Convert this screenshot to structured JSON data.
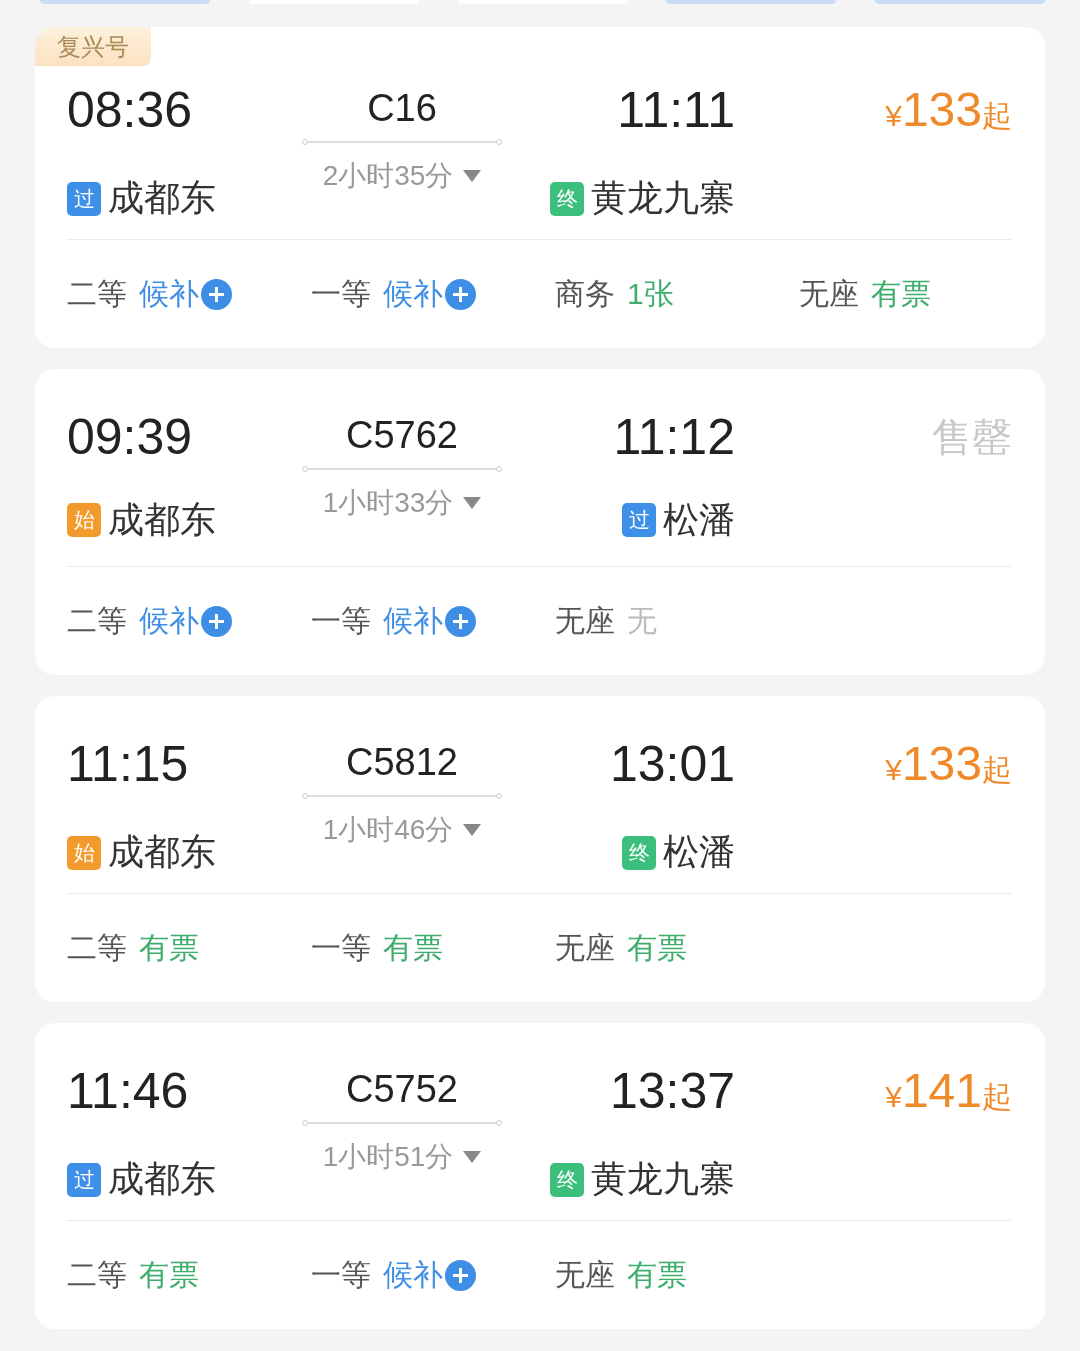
{
  "filter_chips": [
    {
      "selected": true
    },
    {
      "selected": false
    },
    {
      "selected": false
    },
    {
      "selected": true
    },
    {
      "selected": true
    }
  ],
  "trains": [
    {
      "tag": "复兴号",
      "depart": {
        "time": "08:36",
        "badge": {
          "text": "过",
          "kind": "pass"
        },
        "station": "成都东"
      },
      "number": "C16",
      "duration": "2小时35分",
      "arrive": {
        "time": "11:11",
        "badge": {
          "text": "终",
          "kind": "end"
        },
        "station": "黄龙九寨"
      },
      "fare": {
        "kind": "price",
        "currency": "¥",
        "amount": "133",
        "suffix": "起"
      },
      "seats": [
        {
          "label": "二等",
          "status": "候补",
          "kind": "waitlist"
        },
        {
          "label": "一等",
          "status": "候补",
          "kind": "waitlist"
        },
        {
          "label": "商务",
          "status": "1张",
          "kind": "available"
        },
        {
          "label": "无座",
          "status": "有票",
          "kind": "available"
        }
      ]
    },
    {
      "depart": {
        "time": "09:39",
        "badge": {
          "text": "始",
          "kind": "start"
        },
        "station": "成都东"
      },
      "number": "C5762",
      "duration": "1小时33分",
      "arrive": {
        "time": "11:12",
        "badge": {
          "text": "过",
          "kind": "pass"
        },
        "station": "松潘"
      },
      "fare": {
        "kind": "sold_out",
        "text": "售罄"
      },
      "seats": [
        {
          "label": "二等",
          "status": "候补",
          "kind": "waitlist"
        },
        {
          "label": "一等",
          "status": "候补",
          "kind": "waitlist"
        },
        {
          "label": "无座",
          "status": "无",
          "kind": "none"
        }
      ]
    },
    {
      "depart": {
        "time": "11:15",
        "badge": {
          "text": "始",
          "kind": "start"
        },
        "station": "成都东"
      },
      "number": "C5812",
      "duration": "1小时46分",
      "arrive": {
        "time": "13:01",
        "badge": {
          "text": "终",
          "kind": "end"
        },
        "station": "松潘"
      },
      "fare": {
        "kind": "price",
        "currency": "¥",
        "amount": "133",
        "suffix": "起"
      },
      "seats": [
        {
          "label": "二等",
          "status": "有票",
          "kind": "available"
        },
        {
          "label": "一等",
          "status": "有票",
          "kind": "available"
        },
        {
          "label": "无座",
          "status": "有票",
          "kind": "available"
        }
      ]
    },
    {
      "depart": {
        "time": "11:46",
        "badge": {
          "text": "过",
          "kind": "pass"
        },
        "station": "成都东"
      },
      "number": "C5752",
      "duration": "1小时51分",
      "arrive": {
        "time": "13:37",
        "badge": {
          "text": "终",
          "kind": "end"
        },
        "station": "黄龙九寨"
      },
      "fare": {
        "kind": "price",
        "currency": "¥",
        "amount": "141",
        "suffix": "起"
      },
      "seats": [
        {
          "label": "二等",
          "status": "有票",
          "kind": "available"
        },
        {
          "label": "一等",
          "status": "候补",
          "kind": "waitlist"
        },
        {
          "label": "无座",
          "status": "有票",
          "kind": "available"
        }
      ]
    }
  ]
}
